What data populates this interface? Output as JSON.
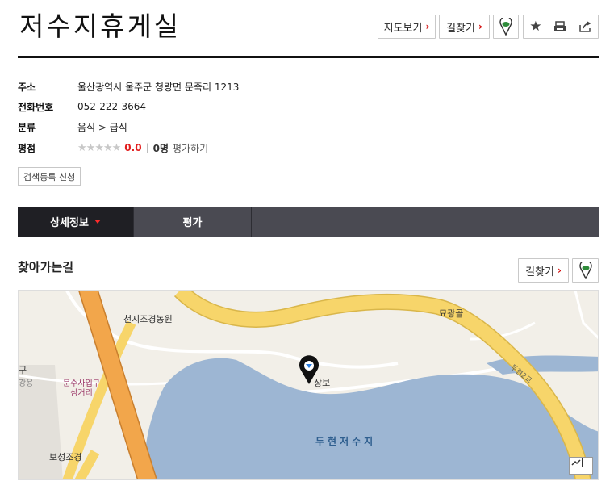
{
  "header": {
    "title": "저수지휴게실",
    "map_view_label": "지도보기",
    "directions_label": "길찾기"
  },
  "info": {
    "address_label": "주소",
    "address": "울산광역시 울주군 청량면 문죽리 1213",
    "phone_label": "전화번호",
    "phone": "052-222-3664",
    "category_label": "분류",
    "category": "음식 > 급식",
    "rating_label": "평점",
    "rating_value": "0.0",
    "rating_count": "0명",
    "review_link": "평가하기",
    "register_button": "검색등록 신청"
  },
  "tabs": [
    {
      "label": "상세정보",
      "active": true
    },
    {
      "label": "평가",
      "active": false
    }
  ],
  "directions_section": {
    "title": "찾아가는길",
    "directions_label": "길찾기"
  },
  "map": {
    "labels": {
      "garden": "천지조경농원",
      "myogwang": "묘광골",
      "sangbo": "상보",
      "junction_line1": "문수사입구",
      "junction_line2": "삼거리",
      "boseong": "보성조경",
      "lake": "두현저수지",
      "bridge": "두현2교",
      "gu": "구",
      "gu_sub": "강용"
    }
  },
  "colors": {
    "accent_red": "#d20a0a",
    "tab_dark": "#1f1f24",
    "tab_bar": "#4a4a52",
    "road_yellow": "#f7d56a",
    "highway_orange": "#f2a64b",
    "water": "#9db6d3",
    "pin_green": "#2e8b3a"
  },
  "icons": {
    "chevron": "chevron-right-icon",
    "pin": "location-pin-icon",
    "star": "star-icon",
    "print": "print-icon",
    "share": "share-icon"
  }
}
